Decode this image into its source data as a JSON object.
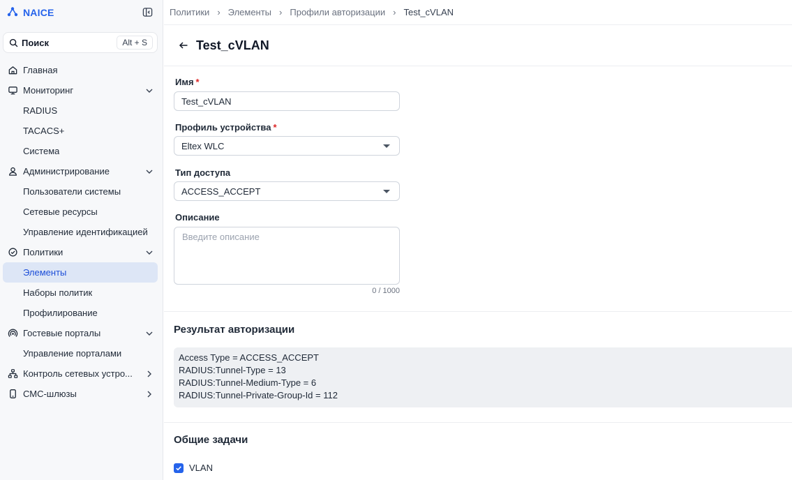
{
  "app": {
    "name": "NAICE"
  },
  "search": {
    "label": "Поиск",
    "shortcut": "Alt + S"
  },
  "sidebar": {
    "items": [
      {
        "label": "Главная",
        "icon": "home-icon",
        "level": 0
      },
      {
        "label": "Мониторинг",
        "icon": "monitor-icon",
        "level": 0,
        "chevron": "down"
      },
      {
        "label": "RADIUS",
        "level": 1
      },
      {
        "label": "TACACS+",
        "level": 1
      },
      {
        "label": "Система",
        "level": 1
      },
      {
        "label": "Администрирование",
        "icon": "user-icon",
        "level": 0,
        "chevron": "down"
      },
      {
        "label": "Пользователи системы",
        "level": 1
      },
      {
        "label": "Сетевые ресурсы",
        "level": 1
      },
      {
        "label": "Управление идентификацией",
        "level": 1
      },
      {
        "label": "Политики",
        "icon": "shield-check-icon",
        "level": 0,
        "chevron": "down"
      },
      {
        "label": "Элементы",
        "level": 1,
        "active": true
      },
      {
        "label": "Наборы политик",
        "level": 1
      },
      {
        "label": "Профилирование",
        "level": 1
      },
      {
        "label": "Гостевые порталы",
        "icon": "wireless-icon",
        "level": 0,
        "chevron": "down"
      },
      {
        "label": "Управление порталами",
        "level": 1
      },
      {
        "label": "Контроль сетевых устро...",
        "icon": "network-icon",
        "level": 0,
        "chevron": "right"
      },
      {
        "label": "СМС-шлюзы",
        "icon": "phone-icon",
        "level": 0,
        "chevron": "right"
      }
    ]
  },
  "breadcrumb": [
    "Политики",
    "Элементы",
    "Профили авторизации",
    "Test_cVLAN"
  ],
  "page": {
    "title": "Test_cVLAN"
  },
  "form": {
    "name": {
      "label": "Имя",
      "required_mark": "*",
      "value": "Test_cVLAN"
    },
    "device_profile": {
      "label": "Профиль устройства",
      "required_mark": "*",
      "value": "Eltex WLC"
    },
    "access_type": {
      "label": "Тип доступа",
      "value": "ACCESS_ACCEPT"
    },
    "description": {
      "label": "Описание",
      "placeholder": "Введите описание",
      "counter": "0 / 1000"
    }
  },
  "result": {
    "title": "Результат авторизации",
    "lines": [
      "Access Type = ACCESS_ACCEPT",
      "RADIUS:Tunnel-Type = 13",
      "RADIUS:Tunnel-Medium-Type = 6",
      "RADIUS:Tunnel-Private-Group-Id = 112"
    ]
  },
  "common_tasks": {
    "title": "Общие задачи",
    "items": [
      {
        "label": "VLAN",
        "checked": true
      }
    ]
  },
  "colors": {
    "accent": "#2563eb",
    "active_bg": "#dde6f6",
    "required": "#dc2626"
  }
}
